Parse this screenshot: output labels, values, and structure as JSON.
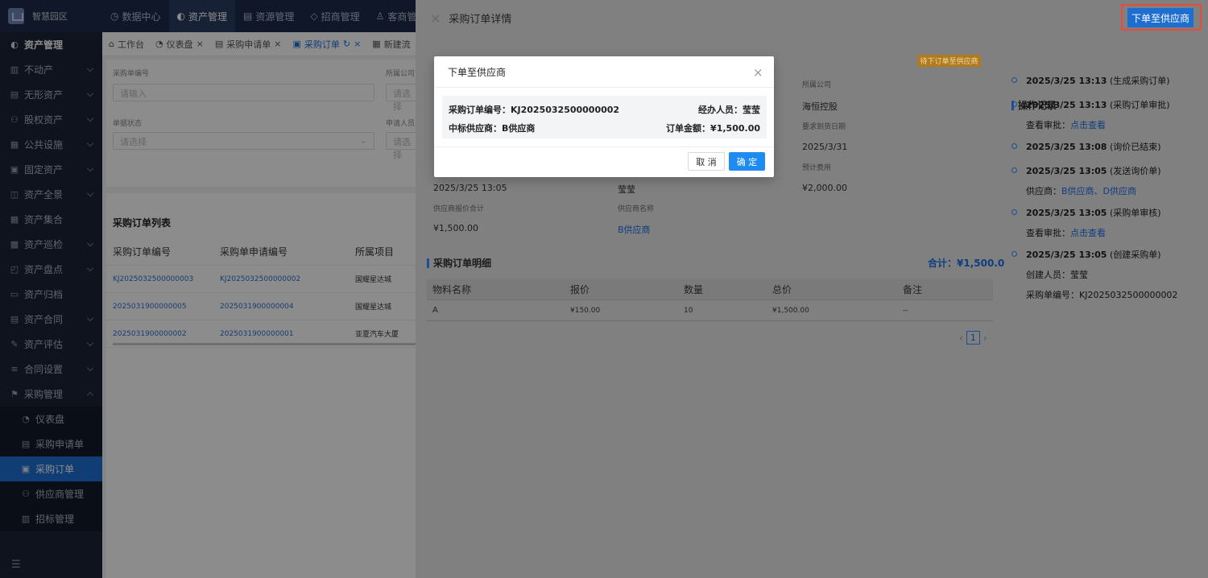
{
  "app": {
    "name": "智慧园区"
  },
  "topnav": [
    {
      "label": "数据中心",
      "icon": "clock-icon",
      "active": false
    },
    {
      "label": "资产管理",
      "icon": "shield-icon",
      "active": true
    },
    {
      "label": "资源管理",
      "icon": "document-icon",
      "active": false
    },
    {
      "label": "招商管理",
      "icon": "tag-icon",
      "active": false
    },
    {
      "label": "客商管理",
      "icon": "user-icon",
      "active": false
    }
  ],
  "sidebar": {
    "header": "资产管理",
    "items": [
      {
        "label": "不动产"
      },
      {
        "label": "无形资产"
      },
      {
        "label": "股权资产"
      },
      {
        "label": "公共设施"
      },
      {
        "label": "固定资产"
      },
      {
        "label": "资产全景"
      },
      {
        "label": "资产集合"
      },
      {
        "label": "资产巡检"
      },
      {
        "label": "资产盘点"
      },
      {
        "label": "资产归档"
      },
      {
        "label": "资产合同"
      },
      {
        "label": "资产评估"
      },
      {
        "label": "合同设置"
      },
      {
        "label": "采购管理"
      }
    ],
    "subitems": [
      {
        "label": "仪表盘",
        "active": false
      },
      {
        "label": "采购申请单",
        "active": false
      },
      {
        "label": "采购订单",
        "active": true
      },
      {
        "label": "供应商管理",
        "active": false
      },
      {
        "label": "招标管理",
        "active": false
      }
    ]
  },
  "tabs": [
    {
      "label": "工作台",
      "active": false
    },
    {
      "label": "仪表盘",
      "active": false
    },
    {
      "label": "采购申请单",
      "active": false
    },
    {
      "label": "采购订单",
      "active": true
    },
    {
      "label": "新建流",
      "active": false
    }
  ],
  "filters": {
    "order_no_label": "采购单编号",
    "order_no_placeholder": "请输入",
    "company_label": "所属公司",
    "company_placeholder": "请选择",
    "status_label": "单据状态",
    "status_placeholder": "请选择",
    "applicant_label": "申请人员",
    "applicant_placeholder": "请选择"
  },
  "list": {
    "title": "采购订单列表",
    "headers": [
      "采购订单编号",
      "采购单申请编号",
      "所属项目"
    ],
    "rows": [
      [
        "KJ2025032500000003",
        "KJ2025032500000002",
        "国耀星达城"
      ],
      [
        "2025031900000005",
        "2025031900000004",
        "国耀星达城"
      ],
      [
        "2025031900000002",
        "2025031900000001",
        "亚夏汽车大厦"
      ]
    ]
  },
  "drawer": {
    "title": "采购订单详情",
    "top_button": "下单至供应商",
    "status_badge": "待下订单至供应商",
    "fields": {
      "company_label": "所属公司",
      "company_value": "海恒控股",
      "delivery_label": "要求到货日期",
      "delivery_value": "2025/3/31",
      "budget_label": "预计费用",
      "budget_value": "¥2,000.00",
      "created_value": "2025/3/25 13:05",
      "handler_value": "莹莹",
      "quote_total_label": "供应商报价合计",
      "quote_total_value": "¥1,500.00",
      "supplier_label": "供应商名称",
      "supplier_value": "B供应商"
    },
    "detail": {
      "title": "采购订单明细",
      "total": "合计：¥1,500.00",
      "headers": [
        "物料名称",
        "报价",
        "数量",
        "总价",
        "备注"
      ],
      "rows": [
        [
          "A",
          "¥150.00",
          "10",
          "¥1,500.00",
          "--"
        ]
      ],
      "page": "1"
    },
    "log": {
      "title": "操作记录",
      "items": [
        {
          "time": "2025/3/25 13:13",
          "action": "(生成采购订单)",
          "sub_label": "",
          "sub_value": ""
        },
        {
          "time": "2025/3/25 13:13",
          "action": "(采购订单审批)",
          "sub_label": "查看审批：",
          "sub_value": "点击查看"
        },
        {
          "time": "2025/3/25 13:08",
          "action": "(询价已结束)",
          "sub_label": "",
          "sub_value": ""
        },
        {
          "time": "2025/3/25 13:05",
          "action": "(发送询价单)",
          "sub_label": "供应商：",
          "sub_value": "B供应商、D供应商"
        },
        {
          "time": "2025/3/25 13:05",
          "action": "(采购单审核)",
          "sub_label": "查看审批：",
          "sub_value": "点击查看"
        },
        {
          "time": "2025/3/25 13:05",
          "action": "(创建采购单)",
          "sub_label": "创建人员：莹莹",
          "sub_value": "",
          "sub2": "采购单编号：KJ2025032500000002"
        }
      ]
    }
  },
  "modal": {
    "title": "下单至供应商",
    "order_no": "采购订单编号：KJ2025032500000002",
    "handler": "经办人员：莹莹",
    "supplier": "中标供应商：B供应商",
    "amount": "订单金额：¥1,500.00",
    "cancel": "取 消",
    "confirm": "确 定"
  },
  "colors": {
    "primary": "#1e8bf0",
    "sidebar_bg": "#1a2438",
    "topbar_bg": "#1c2a4a",
    "highlight_border": "#e64b3c"
  }
}
